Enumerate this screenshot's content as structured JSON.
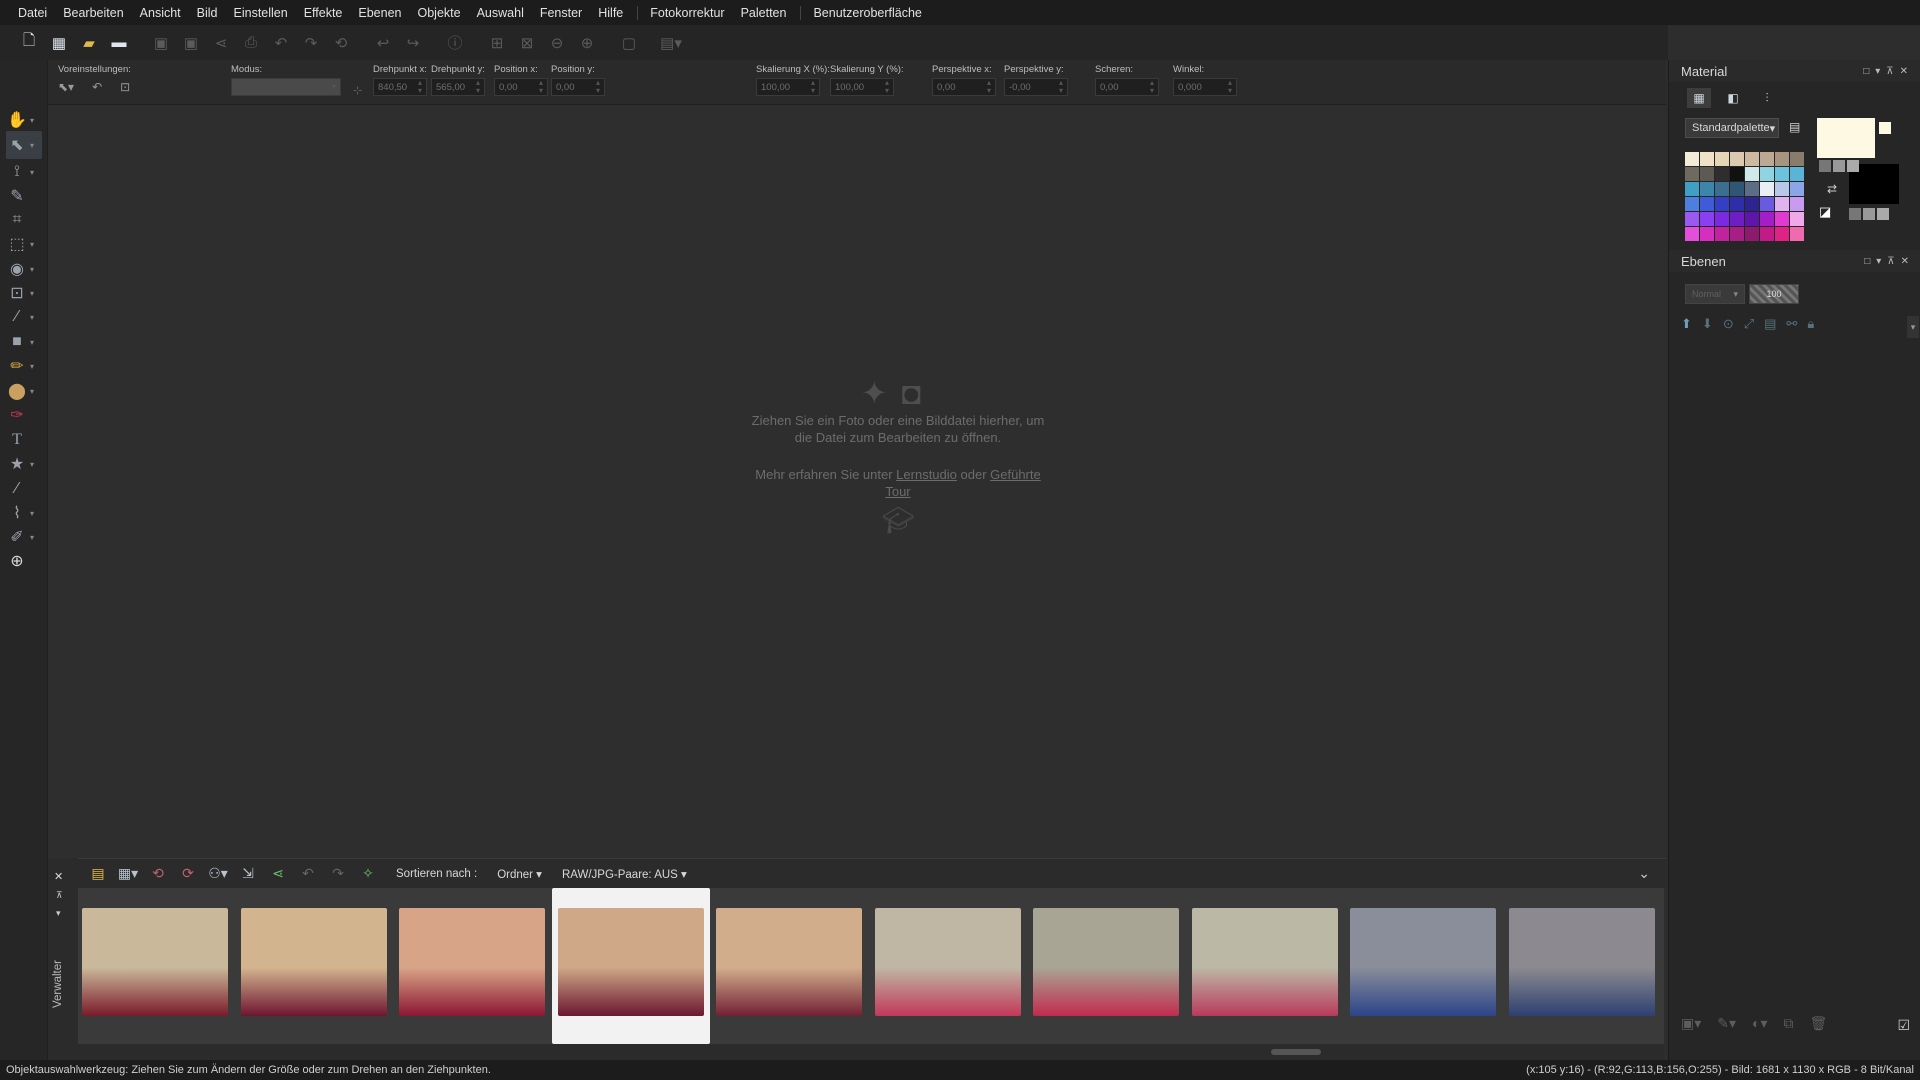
{
  "menu": [
    "Datei",
    "Bearbeiten",
    "Ansicht",
    "Bild",
    "Einstellen",
    "Effekte",
    "Ebenen",
    "Objekte",
    "Auswahl",
    "Fenster",
    "Hilfe",
    "Fotokorrektur",
    "Paletten",
    "Benutzeroberfläche"
  ],
  "options": {
    "voreinstellungen_label": "Voreinstellungen:",
    "modus_label": "Modus:",
    "drehpunkt_x_label": "Drehpunkt x:",
    "drehpunkt_x": "840,50",
    "drehpunkt_y_label": "Drehpunkt y:",
    "drehpunkt_y": "565,00",
    "position_x_label": "Position x:",
    "position_x": "0,00",
    "position_y_label": "Position y:",
    "position_y": "0,00",
    "skal_x_label": "Skalierung X (%):",
    "skal_x": "100,00",
    "skal_y_label": "Skalierung Y (%):",
    "skal_y": "100,00",
    "persp_x_label": "Perspektive x:",
    "persp_x": "0,00",
    "persp_y_label": "Perspektive y:",
    "persp_y": "-0,00",
    "scheren_label": "Scheren:",
    "scheren": "0,00",
    "winkel_label": "Winkel:",
    "winkel": "0,000"
  },
  "welcome": {
    "line1": "Ziehen Sie ein Foto oder eine Bilddatei hierher, um die Datei zum Bearbeiten zu öffnen.",
    "learn_prefix": "Mehr erfahren Sie unter ",
    "learn_link1": "Lernstudio",
    "learn_mid": " oder ",
    "learn_link2": "Geführte Tour"
  },
  "material": {
    "title": "Material",
    "palette_select": "Standardpalette",
    "swatch_colors": [
      "#f4ecd8",
      "#efe2c6",
      "#e6d6b8",
      "#dccab0",
      "#cdb9a0",
      "#bda993",
      "#a7957f",
      "#8a7c6c",
      "#6f6a60",
      "#5d5a54",
      "#2e2e2e",
      "#111111",
      "#cfe9ea",
      "#8fd4e0",
      "#6cc4dc",
      "#5ab4d8",
      "#3fa0c6",
      "#3b86aa",
      "#3c6e8f",
      "#2f5673",
      "#5b6e86",
      "#e8eef4",
      "#b8c8e8",
      "#8aa6e6",
      "#4d7fe0",
      "#3e5cd8",
      "#3440c4",
      "#2e2ea8",
      "#2d2490",
      "#6a5ae0",
      "#e0b2f0",
      "#c89af0",
      "#9b59f0",
      "#8a3ff0",
      "#7a2ae0",
      "#6d1ec4",
      "#5e16a8",
      "#a41ec8",
      "#e03ad0",
      "#f0a8e8",
      "#e24fd8",
      "#d62fc0",
      "#c2229e",
      "#a81e84",
      "#8e1a6e",
      "#c21a86",
      "#e02284",
      "#f06ab0"
    ],
    "fg_color": "#fdf9e2",
    "bg_color": "#000000"
  },
  "layers": {
    "title": "Ebenen",
    "blend_mode": "Normal",
    "opacity": "100"
  },
  "manager": {
    "sort_label": "Sortieren nach :",
    "sort_value": "Ordner",
    "raw_pair": "RAW/JPG-Paare: AUS",
    "side_label": "Verwalter"
  },
  "thumbs": [
    {
      "c1": "#c9b99a",
      "c2": "#7a1a2a"
    },
    {
      "c1": "#d2b58f",
      "c2": "#6e1530"
    },
    {
      "c1": "#d8a487",
      "c2": "#8c1632"
    },
    {
      "c1": "#cfa887",
      "c2": "#6a1730"
    },
    {
      "c1": "#d2ad8c",
      "c2": "#722034"
    },
    {
      "c1": "#bfb7a4",
      "c2": "#c2385a"
    },
    {
      "c1": "#a8a594",
      "c2": "#c02b4e"
    },
    {
      "c1": "#bcb8a6",
      "c2": "#b83a5c"
    },
    {
      "c1": "#8a8e9a",
      "c2": "#2c4488"
    },
    {
      "c1": "#8c8a90",
      "c2": "#2e4070"
    }
  ],
  "status": {
    "left": "Objektauswahlwerkzeug: Ziehen Sie zum Ändern der Größe oder zum Drehen an den Ziehpunkten.",
    "right": "(x:105 y:16) - (R:92,G:113,B:156,O:255) - Bild:  1681 x 1130 x RGB - 8 Bit/Kanal"
  }
}
